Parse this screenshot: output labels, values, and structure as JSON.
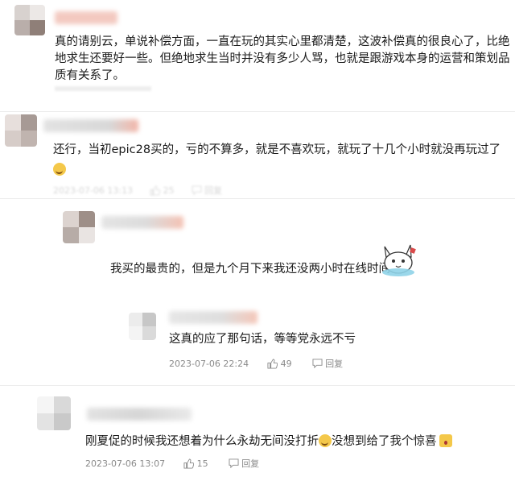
{
  "comments": [
    {
      "text_lines": [
        "真的请别云，单说补偿方面，一直在玩的其实心里都清楚，这波补偿真的很良心了，比绝",
        "地求生还要好一些。但绝地求生当时并没有多少人骂，也就是跟游戏本身的运营和策划品",
        "质有关系了。"
      ]
    },
    {
      "text": "还行，当初epic28买的，亏的不算多，就是不喜欢玩，就玩了十几个小时就没再玩过了",
      "date": "2023-07-06 13:13",
      "likes": "25",
      "reply_label": "回复"
    },
    {
      "text": "我买的最贵的，但是九个月下来我还没两小时在线时间"
    },
    {
      "text": "这真的应了那句话，等等党永远不亏",
      "date": "2023-07-06 22:24",
      "likes": "49",
      "reply_label": "回复"
    },
    {
      "text": "刚夏促的时候我还想着为什么永劫无间没打折",
      "text_after_emoji": "没想到给了我个惊喜",
      "date": "2023-07-06 13:07",
      "likes": "15",
      "reply_label": "回复"
    }
  ],
  "icons": {
    "like": "thumbs-up-icon",
    "reply": "comment-bubble-icon",
    "emoji_laugh": "laughing-emoji-icon",
    "emoji_surprise": "surprised-emoji-icon",
    "sticker": "cartoon-cat-sticker"
  },
  "colors": {
    "meta_text": "#8a8a8a",
    "name_blur_pink": "#f3c9c0",
    "name_blur_gray": "#dcdcdc"
  }
}
